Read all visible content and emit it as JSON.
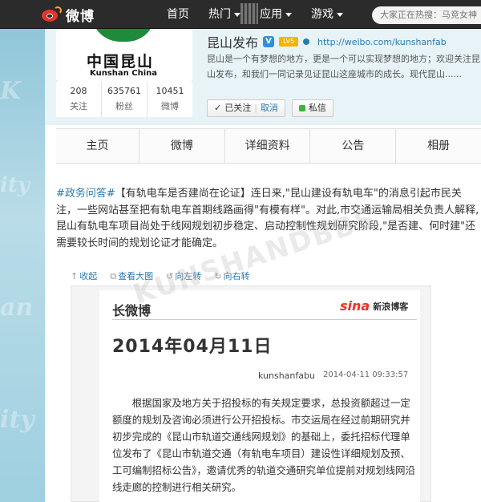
{
  "topbar": {
    "logo_text": "微博",
    "nav": [
      {
        "label": "首页",
        "has_caret": false
      },
      {
        "label": "热门",
        "has_caret": true
      },
      {
        "label": "应用",
        "has_caret": true
      },
      {
        "label": "游戏",
        "has_caret": true
      }
    ],
    "search_placeholder": "大家正在热搜：马竞女神"
  },
  "profile": {
    "avatar_cn": "中国昆山",
    "avatar_en": "Kunshan China",
    "stats": [
      {
        "num": "208",
        "label": "关注"
      },
      {
        "num": "635761",
        "label": "粉丝"
      },
      {
        "num": "10451",
        "label": "微博"
      }
    ],
    "name": "昆山发布",
    "verified_badge": "V",
    "level_badge": "LV5",
    "url": "http://weibo.com/kunshanfab",
    "intro": "昆山是一个有梦想的地方，更是一个可以实现梦想的地方；欢迎关注昆山发布，和我们一同记录见证昆山这座城市的成长。现代昆山......",
    "follow_label": "已关注",
    "cancel_label": "取消",
    "message_label": "私信"
  },
  "tabs": [
    "主页",
    "微博",
    "详细资料",
    "公告",
    "相册"
  ],
  "post": {
    "tag": "#政务问答#",
    "text": "【有轨电车是否建尚在论证】连日来,\"昆山建设有轨电车\"的消息引起市民关注，一些网站甚至把有轨电车首期线路画得\"有模有样\"。对此,市交通运输局相关负责人解释,昆山有轨电车项目尚处于线网规划初步稳定、启动控制性规划研究阶段,\"是否建、何时建\"还需要较长时间的规划论证才能确定。",
    "toolbar": [
      "收起",
      "查看大图",
      "向左转",
      "向右转"
    ]
  },
  "long_weibo": {
    "header": "长微博",
    "sina_logo": "sina",
    "sina_label": "新浪博客",
    "date": "2014年04月11日",
    "author": "kunshanfabu",
    "time": "2014-04-11 09:33:57",
    "body": "根据国家及地方关于招投标的有关规定要求，总投资额超过一定额度的规划及咨询必须进行公开招投标。市交运局在经过前期研究并初步完成的《昆山市轨道交通线网规划》的基础上，委托招标代理单位发布了《昆山市轨道交通（有轨电车项目）建设性详细规划及预、工可编制招标公告》，邀请优秀的轨道交通研究单位提前对规划线网沿线走廊的控制进行相关研究。"
  },
  "colors": {
    "topbar": "#2b2b2b",
    "link": "#2a7ab0",
    "weibo_red": "#e8322b"
  }
}
